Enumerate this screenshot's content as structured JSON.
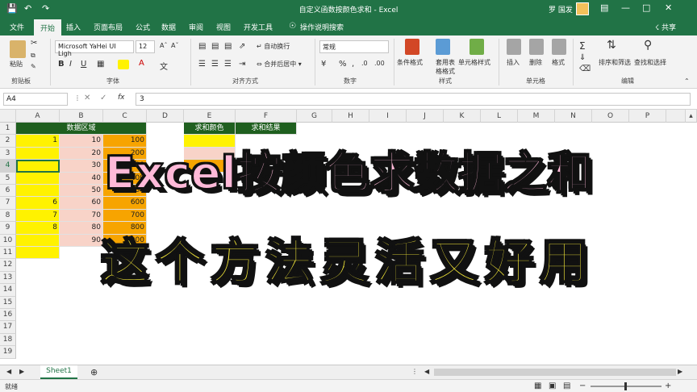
{
  "titlebar": {
    "title": "自定义函数按颜色求和 - Excel",
    "user": "罗 国发"
  },
  "tabs": [
    "文件",
    "开始",
    "插入",
    "页面布局",
    "公式",
    "数据",
    "审阅",
    "视图",
    "开发工具",
    "操作说明搜索"
  ],
  "share": "共享",
  "ribbon": {
    "clipboard": {
      "paste": "粘贴",
      "label": "剪贴板"
    },
    "font": {
      "name": "Microsoft YaHei UI Ligh",
      "size": "12",
      "label": "字体"
    },
    "align": {
      "wrap": "自动换行",
      "merge": "合并后居中",
      "label": "对齐方式"
    },
    "number": {
      "format": "常规",
      "label": "数字"
    },
    "styles": {
      "cond": "条件格式",
      "table": "套用表格格式",
      "cell": "单元格样式",
      "label": "样式"
    },
    "cells": {
      "insert": "插入",
      "delete": "删除",
      "format": "格式",
      "label": "单元格"
    },
    "edit": {
      "sort": "排序和筛选",
      "find": "查找和选择",
      "label": "编辑"
    }
  },
  "formula_bar": {
    "name_box": "A4",
    "fx": "fx",
    "value": "3"
  },
  "columns": [
    "A",
    "B",
    "C",
    "D",
    "E",
    "F",
    "G",
    "H",
    "I",
    "J",
    "K",
    "L",
    "M",
    "N",
    "O",
    "P"
  ],
  "rows": [
    "1",
    "2",
    "3",
    "4",
    "5",
    "6",
    "7",
    "8",
    "9",
    "10",
    "11",
    "12",
    "13",
    "14",
    "15",
    "16",
    "17",
    "18",
    "19"
  ],
  "sheet": {
    "header_data": "数据区域",
    "header_color": "求和颜色",
    "header_result": "求和结果",
    "colA": [
      "1",
      "",
      "",
      "",
      "",
      "6",
      "7",
      "8",
      ""
    ],
    "colB": [
      "10",
      "20",
      "30",
      "40",
      "50",
      "60",
      "70",
      "80",
      "90"
    ],
    "colC": [
      "100",
      "200",
      "300",
      "400",
      "500",
      "600",
      "700",
      "800",
      "900"
    ]
  },
  "overlay": {
    "line1": "Excel按颜色求数据之和",
    "line2": "这个方法灵活又好用"
  },
  "sheet_tab": "Sheet1",
  "status": "就绪",
  "colors": {
    "excel_green": "#217346",
    "header_green": "#1f5f1f",
    "yellow": "#fff200",
    "pink": "#f8d3c8",
    "orange": "#f7a400"
  }
}
